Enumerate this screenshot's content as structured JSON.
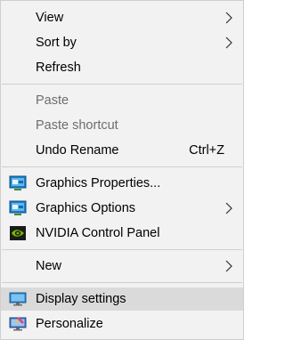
{
  "menu": {
    "items": {
      "view": {
        "label": "View"
      },
      "sort_by": {
        "label": "Sort by"
      },
      "refresh": {
        "label": "Refresh"
      },
      "paste": {
        "label": "Paste"
      },
      "paste_shortcut": {
        "label": "Paste shortcut"
      },
      "undo_rename": {
        "label": "Undo Rename",
        "shortcut": "Ctrl+Z"
      },
      "graphics_properties": {
        "label": "Graphics Properties...",
        "icon": "intel-graphics-icon"
      },
      "graphics_options": {
        "label": "Graphics Options",
        "icon": "intel-graphics-icon"
      },
      "nvidia_control_panel": {
        "label": "NVIDIA Control Panel",
        "icon": "nvidia-icon"
      },
      "new": {
        "label": "New"
      },
      "display_settings": {
        "label": "Display settings",
        "icon": "display-icon"
      },
      "personalize": {
        "label": "Personalize",
        "icon": "personalize-icon"
      }
    },
    "colors": {
      "background": "#f2f2f2",
      "hover": "#dadada",
      "separator": "#cfcfcf",
      "disabled_text": "#6d6d6d"
    }
  }
}
